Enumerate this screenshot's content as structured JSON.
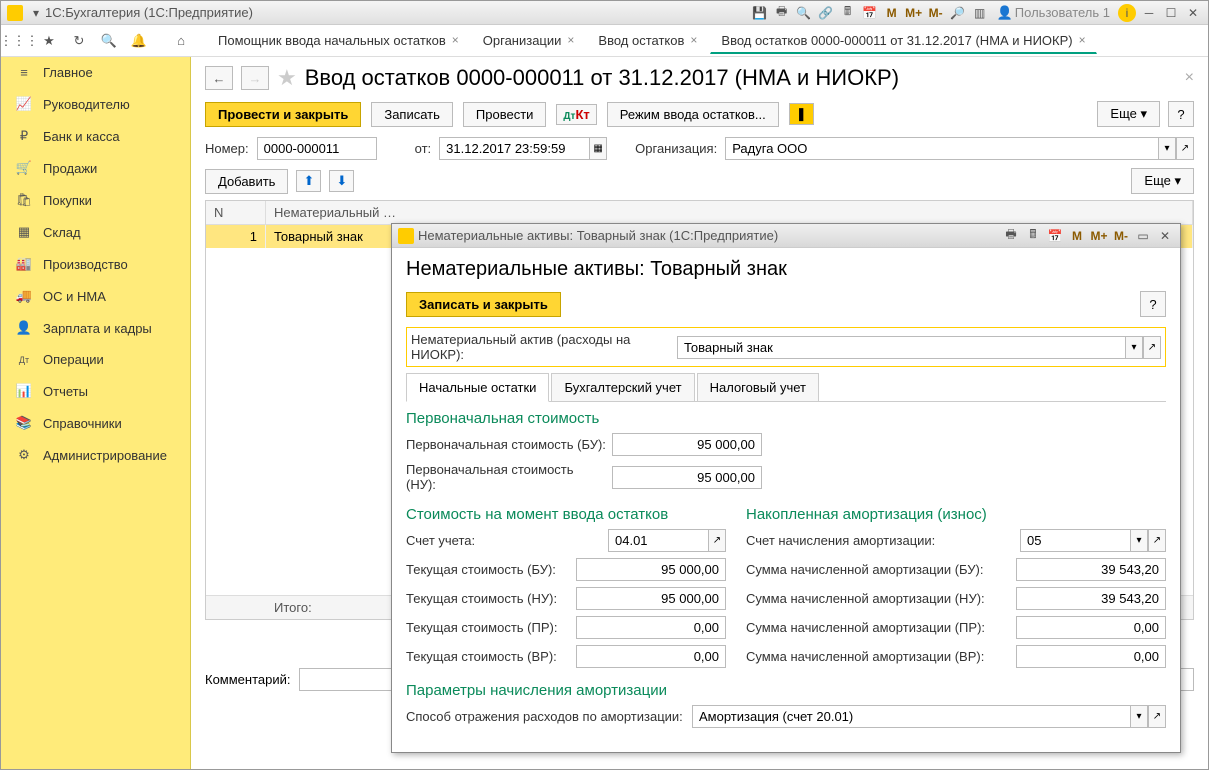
{
  "app_title": "1С:Бухгалтерия  (1С:Предприятие)",
  "user_label": "Пользователь 1",
  "top_tabs": [
    {
      "label": "Помощник ввода начальных остатков"
    },
    {
      "label": "Организации"
    },
    {
      "label": "Ввод остатков"
    },
    {
      "label": "Ввод остатков 0000-000011 от 31.12.2017 (НМА и НИОКР)",
      "active": true
    }
  ],
  "sidebar": [
    {
      "icon": "≡",
      "label": "Главное"
    },
    {
      "icon": "📈",
      "label": "Руководителю"
    },
    {
      "icon": "₽",
      "label": "Банк и касса"
    },
    {
      "icon": "🛒",
      "label": "Продажи"
    },
    {
      "icon": "🛍",
      "label": "Покупки"
    },
    {
      "icon": "▦",
      "label": "Склад"
    },
    {
      "icon": "🏭",
      "label": "Производство"
    },
    {
      "icon": "🚚",
      "label": "ОС и НМА"
    },
    {
      "icon": "👤",
      "label": "Зарплата и кадры"
    },
    {
      "icon": "Дт",
      "label": "Операции"
    },
    {
      "icon": "📊",
      "label": "Отчеты"
    },
    {
      "icon": "📚",
      "label": "Справочники"
    },
    {
      "icon": "⚙",
      "label": "Администрирование"
    }
  ],
  "page": {
    "title": "Ввод остатков 0000-000011 от 31.12.2017 (НМА и НИОКР)",
    "cmd_post_close": "Провести и закрыть",
    "cmd_write": "Записать",
    "cmd_post": "Провести",
    "cmd_mode": "Режим ввода остатков...",
    "more": "Еще",
    "number_label": "Номер:",
    "number": "0000-000011",
    "from_label": "от:",
    "date": "31.12.2017 23:59:59",
    "org_label": "Организация:",
    "org": "Радуга ООО",
    "add": "Добавить",
    "col_n": "N",
    "col_nma": "Нематериальный …",
    "row_n": "1",
    "row_nma": "Товарный знак",
    "total_label": "Итого:",
    "comment_label": "Комментарий:"
  },
  "modal": {
    "window_title": "Нематериальные активы: Товарный знак  (1С:Предприятие)",
    "title": "Нематериальные активы: Товарный знак",
    "save_close": "Записать и закрыть",
    "nma_label": "Нематериальный актив (расходы на НИОКР):",
    "nma_value": "Товарный знак",
    "tabs": [
      "Начальные остатки",
      "Бухгалтерский учет",
      "Налоговый учет"
    ],
    "sec_initial": "Первоначальная стоимость",
    "init_bu_label": "Первоначальная стоимость (БУ):",
    "init_bu": "95 000,00",
    "init_nu_label": "Первоначальная стоимость (НУ):",
    "init_nu": "95 000,00",
    "sec_cost": "Стоимость на момент ввода остатков",
    "sec_amort": "Накопленная амортизация (износ)",
    "acct_label": "Счет учета:",
    "acct": "04.01",
    "amort_acct_label": "Счет начисления амортизации:",
    "amort_acct": "05",
    "cur_bu_label": "Текущая стоимость (БУ):",
    "cur_bu": "95 000,00",
    "cur_nu_label": "Текущая стоимость (НУ):",
    "cur_nu": "95 000,00",
    "cur_pr_label": "Текущая стоимость (ПР):",
    "cur_pr": "0,00",
    "cur_vr_label": "Текущая стоимость (ВР):",
    "cur_vr": "0,00",
    "am_bu_label": "Сумма начисленной амортизации (БУ):",
    "am_bu": "39 543,20",
    "am_nu_label": "Сумма начисленной амортизации (НУ):",
    "am_nu": "39 543,20",
    "am_pr_label": "Сумма начисленной амортизации (ПР):",
    "am_pr": "0,00",
    "am_vr_label": "Сумма начисленной амортизации (ВР):",
    "am_vr": "0,00",
    "sec_params": "Параметры начисления амортизации",
    "method_label": "Способ отражения расходов по амортизации:",
    "method": "Амортизация (счет 20.01)"
  }
}
